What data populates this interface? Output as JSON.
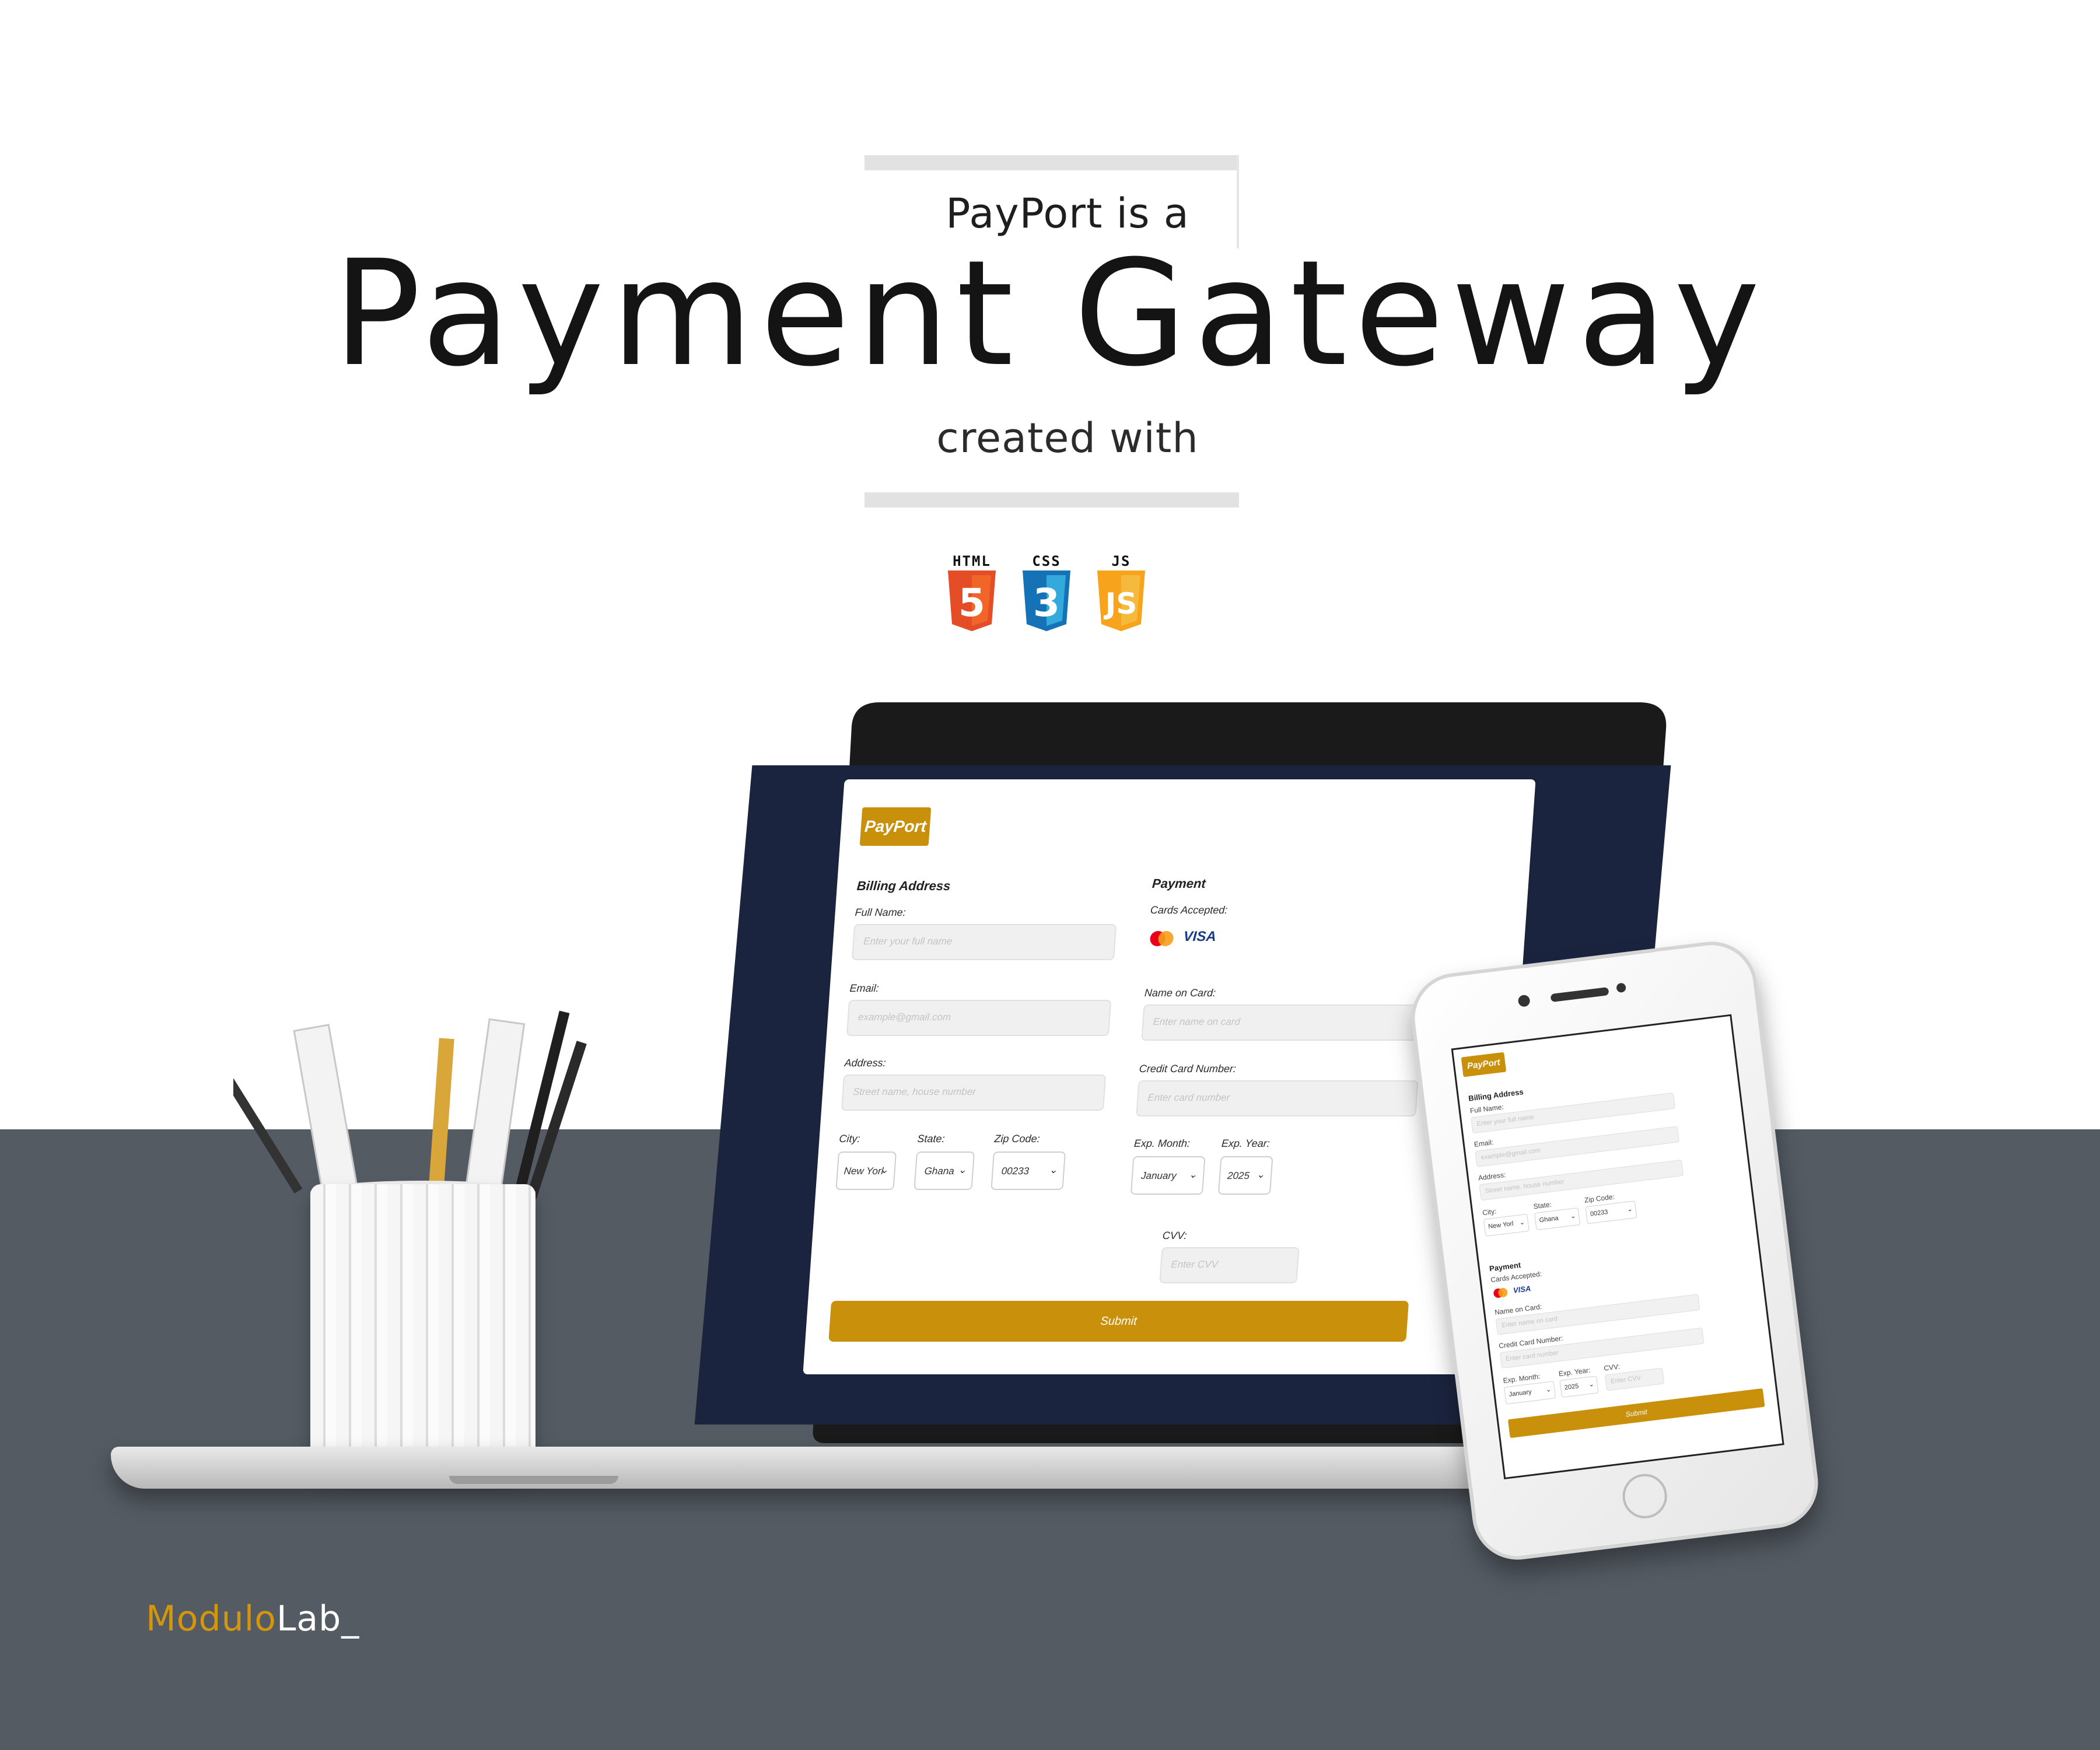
{
  "hero": {
    "kicker": "PayPort is a",
    "title": "Payment Gateway",
    "subline": "created with"
  },
  "tech": [
    {
      "label": "HTML",
      "digit": "5",
      "color": "#e44d26"
    },
    {
      "label": "CSS",
      "digit": "3",
      "color": "#1572b6"
    },
    {
      "label": "JS",
      "digit": "JS",
      "color": "#f7a31c"
    }
  ],
  "app": {
    "brand": "PayPort",
    "billing": {
      "heading": "Billing Address",
      "full_name_label": "Full Name:",
      "full_name_placeholder": "Enter your full name",
      "email_label": "Email:",
      "email_placeholder": "example@gmail.com",
      "address_label": "Address:",
      "address_placeholder": "Street name, house number",
      "city_label": "City:",
      "city_value": "New Yorl",
      "state_label": "State:",
      "state_value": "Ghana",
      "zip_label": "Zip Code:",
      "zip_value": "00233"
    },
    "payment": {
      "heading": "Payment",
      "cards_label": "Cards Accepted:",
      "visa_text": "VISA",
      "name_label": "Name on Card:",
      "name_placeholder": "Enter name on card",
      "number_label": "Credit Card Number:",
      "number_placeholder": "Enter card number",
      "exp_month_label": "Exp. Month:",
      "exp_month_value": "January",
      "exp_year_label": "Exp. Year:",
      "exp_year_value": "2025",
      "cvv_label": "CVV:",
      "cvv_placeholder": "Enter CVV"
    },
    "submit": "Submit"
  },
  "brand_logo": {
    "part1": "Modulo",
    "part2": "Lab_"
  },
  "colors": {
    "accent": "#c9900c",
    "screen_bg": "#1b243f",
    "floor": "#545b63"
  }
}
